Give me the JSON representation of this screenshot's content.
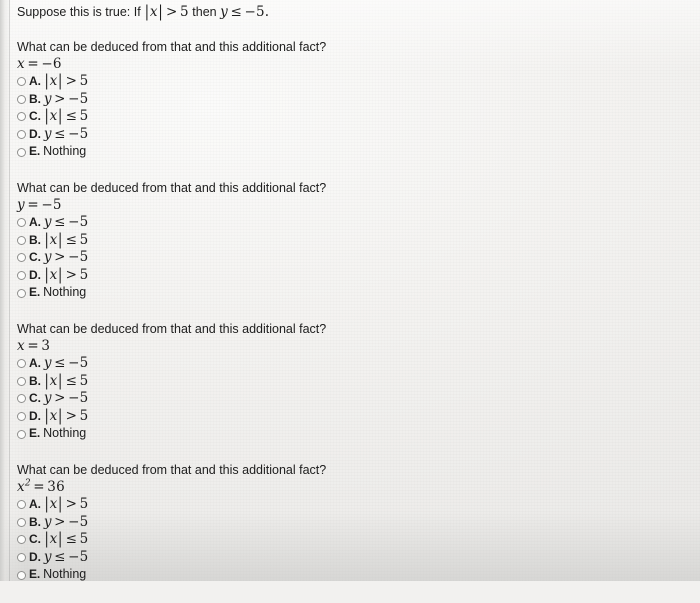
{
  "premise": {
    "lead": "Suppose this is true: If",
    "condition": "|x| > 5",
    "connector": "then",
    "consequent": "y ≤ −5."
  },
  "prompt_text": "What can be deduced from that and this additional fact?",
  "blocks": [
    {
      "fact": "x = −6",
      "options": [
        {
          "letter": "A.",
          "text": "|x| > 5"
        },
        {
          "letter": "B.",
          "text": "y > −5"
        },
        {
          "letter": "C.",
          "text": "|x| ≤ 5"
        },
        {
          "letter": "D.",
          "text": "y ≤ −5"
        },
        {
          "letter": "E.",
          "text": "Nothing"
        }
      ]
    },
    {
      "fact": "y = −5",
      "options": [
        {
          "letter": "A.",
          "text": "y ≤ −5"
        },
        {
          "letter": "B.",
          "text": "|x| ≤ 5"
        },
        {
          "letter": "C.",
          "text": "y > −5"
        },
        {
          "letter": "D.",
          "text": "|x| > 5"
        },
        {
          "letter": "E.",
          "text": "Nothing"
        }
      ]
    },
    {
      "fact": "x = 3",
      "options": [
        {
          "letter": "A.",
          "text": "y ≤ −5"
        },
        {
          "letter": "B.",
          "text": "|x| ≤ 5"
        },
        {
          "letter": "C.",
          "text": "y > −5"
        },
        {
          "letter": "D.",
          "text": "|x| > 5"
        },
        {
          "letter": "E.",
          "text": "Nothing"
        }
      ]
    },
    {
      "fact": "x² = 36",
      "options": [
        {
          "letter": "A.",
          "text": "|x| > 5"
        },
        {
          "letter": "B.",
          "text": "y > −5"
        },
        {
          "letter": "C.",
          "text": "|x| ≤ 5"
        },
        {
          "letter": "D.",
          "text": "y ≤ −5"
        },
        {
          "letter": "E.",
          "text": "Nothing"
        }
      ]
    }
  ],
  "colors": {
    "paper": "#f2f1ef",
    "text": "#1d1d1d",
    "radio_border": "#8f8f8d"
  }
}
